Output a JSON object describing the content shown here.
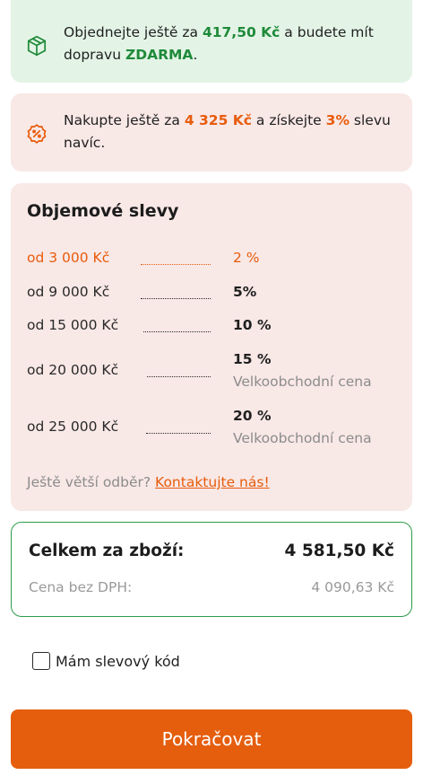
{
  "shipping": {
    "icon": "package-icon",
    "text_before": "Objednejte ještě za ",
    "amount": "417,50 Kč",
    "text_middle": " a budete mít dopravu ",
    "free": "ZDARMA",
    "text_after": ".",
    "accent_color": "#1f8a3a"
  },
  "promo": {
    "icon": "discount-badge-icon",
    "text_before": "Nakupte ještě za ",
    "amount": "4 325 Kč",
    "text_middle": " a získejte ",
    "percent": "3%",
    "text_after": " slevu navíc.",
    "accent_color": "#e85c0d"
  },
  "volume": {
    "title": "Objemové slevy",
    "tiers": [
      {
        "range": "od 3 000 Kč",
        "discount": "2 %",
        "note": "",
        "active": true
      },
      {
        "range": "od 9 000 Kč",
        "discount": "5%",
        "note": "",
        "active": false
      },
      {
        "range": "od 15 000 Kč",
        "discount": "10 %",
        "note": "",
        "active": false
      },
      {
        "range": "od 20 000 Kč",
        "discount": "15 %",
        "note": "Velkoobchodní cena",
        "active": false
      },
      {
        "range": "od 25 000 Kč",
        "discount": "20 %",
        "note": "Velkoobchodní cena",
        "active": false
      }
    ],
    "contact_prefix": "Ještě větší odběr? ",
    "contact_link": "Kontaktujte nás!"
  },
  "total": {
    "label": "Celkem za zboží:",
    "value": "4 581,50 Kč",
    "net_label": "Cena bez DPH:",
    "net_value": "4 090,63 Kč",
    "border_color": "#2c9a4a"
  },
  "coupon": {
    "label": "Mám slevový kód",
    "checked": false
  },
  "continue_button": {
    "label": "Pokračovat",
    "color": "#e55e0e"
  }
}
